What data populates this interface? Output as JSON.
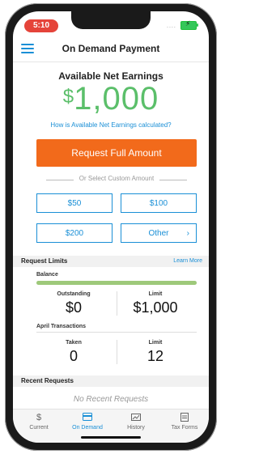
{
  "status_bar": {
    "time": "5:10",
    "signal": "....",
    "battery_icon": "battery-charging-icon"
  },
  "header": {
    "title": "On Demand Payment",
    "menu_icon": "hamburger-menu-icon"
  },
  "earnings": {
    "title": "Available Net Earnings",
    "currency": "$",
    "amount": "1,000",
    "calc_link": "How is Available Net Earnings calculated?"
  },
  "actions": {
    "request_full": "Request Full Amount",
    "custom_divider": "Or Select Custom Amount",
    "amounts": [
      "$50",
      "$100",
      "$200",
      "Other"
    ],
    "other_chevron": "›"
  },
  "limits": {
    "title": "Request Limits",
    "learn_more": "Learn More",
    "balance": {
      "label": "Balance",
      "progress_fraction": 1.0,
      "outstanding_label": "Outstanding",
      "outstanding_value": "$0",
      "limit_label": "Limit",
      "limit_value": "$1,000"
    },
    "april": {
      "label": "April Transactions",
      "taken_label": "Taken",
      "taken_value": "0",
      "limit_label": "Limit",
      "limit_value": "12"
    }
  },
  "recent": {
    "title": "Recent Requests",
    "empty": "No Recent Requests"
  },
  "tabs": [
    {
      "label": "Current",
      "icon": "dollar-icon",
      "active": false
    },
    {
      "label": "On Demand",
      "icon": "card-icon",
      "active": true
    },
    {
      "label": "History",
      "icon": "history-icon",
      "active": false
    },
    {
      "label": "Tax Forms",
      "icon": "document-icon",
      "active": false
    }
  ],
  "colors": {
    "accent": "#1a8fd6",
    "cta": "#f26a1b",
    "amount": "#5bbf6a",
    "progress": "#9ec97a"
  }
}
